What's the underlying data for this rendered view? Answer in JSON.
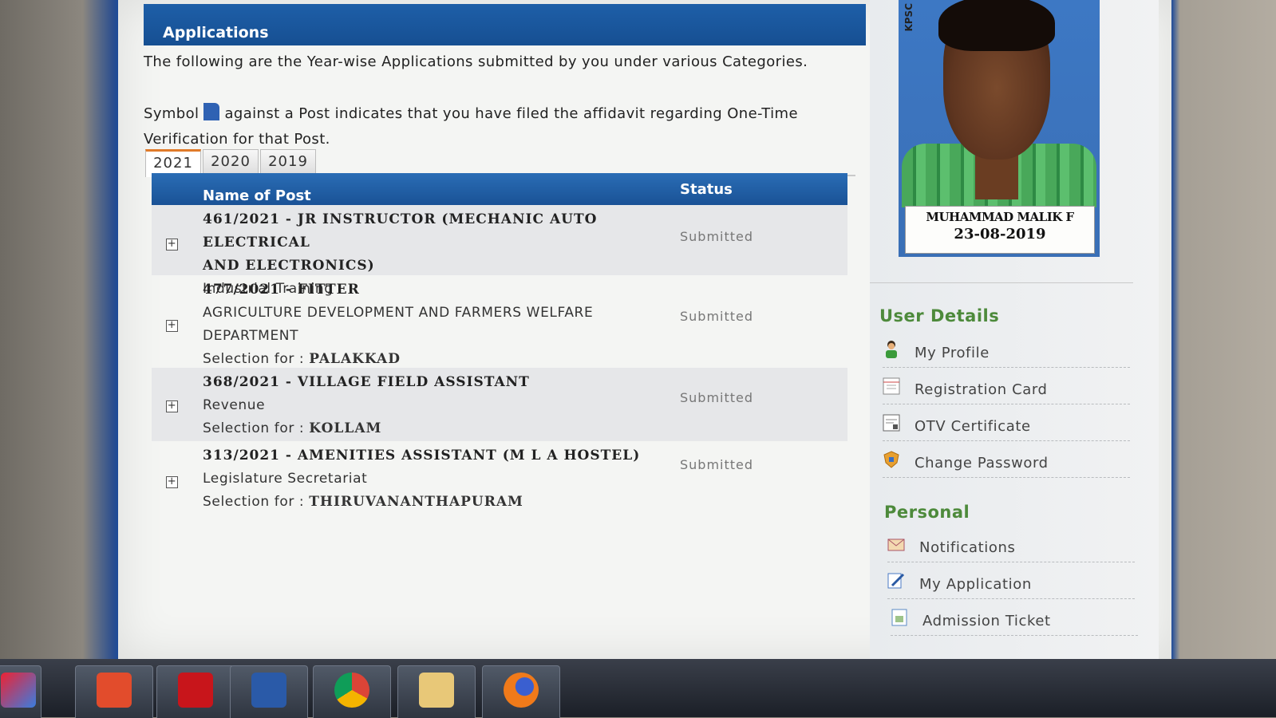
{
  "applications": {
    "header": "Applications",
    "intro": "The following are the Year-wise Applications submitted by you under various Categories.",
    "symbol_before": "Symbol",
    "symbol_after": "against a Post indicates that you have filed the affidavit regarding One-Time Verification for that Post.",
    "tabs": [
      "2021",
      "2020",
      "2019"
    ],
    "active_tab": "2021",
    "columns": {
      "name": "Name of Post",
      "status": "Status"
    },
    "rows": [
      {
        "title_1": "461/2021 - JR INSTRUCTOR (MECHANIC AUTO ELECTRICAL",
        "title_2": "AND ELECTRONICS)",
        "department": "Industrial Training",
        "status": "Submitted"
      },
      {
        "title_1": "477/2021 - FITTER",
        "department_1": "AGRICULTURE DEVELOPMENT AND FARMERS WELFARE",
        "department_2": "DEPARTMENT",
        "selection_label": "Selection for :",
        "selection_value": "PALAKKAD",
        "status": "Submitted"
      },
      {
        "title_1": "368/2021 - VILLAGE FIELD ASSISTANT",
        "department": "Revenue",
        "selection_label": "Selection for :",
        "selection_value": "KOLLAM",
        "status": "Submitted"
      },
      {
        "title_1": "313/2021 - AMENITIES ASSISTANT (M L A HOSTEL)",
        "department": "Legislature Secretariat",
        "selection_label": "Selection for :",
        "selection_value": "THIRUVANANTHAPURAM",
        "status": "Submitted"
      }
    ]
  },
  "profile": {
    "watermark": "KPSC",
    "name": "MUHAMMAD MALIK F",
    "date": "23-08-2019"
  },
  "sidebar": {
    "user_details_heading": "User Details",
    "user_details": [
      "My Profile",
      "Registration Card",
      "OTV Certificate",
      "Change Password"
    ],
    "personal_heading": "Personal",
    "personal": [
      "Notifications",
      "My Application",
      "Admission Ticket"
    ]
  },
  "colors": {
    "header_blue": "#1e5fa8",
    "heading_green": "#4d8a3b",
    "active_tab_accent": "#e07b2a"
  }
}
